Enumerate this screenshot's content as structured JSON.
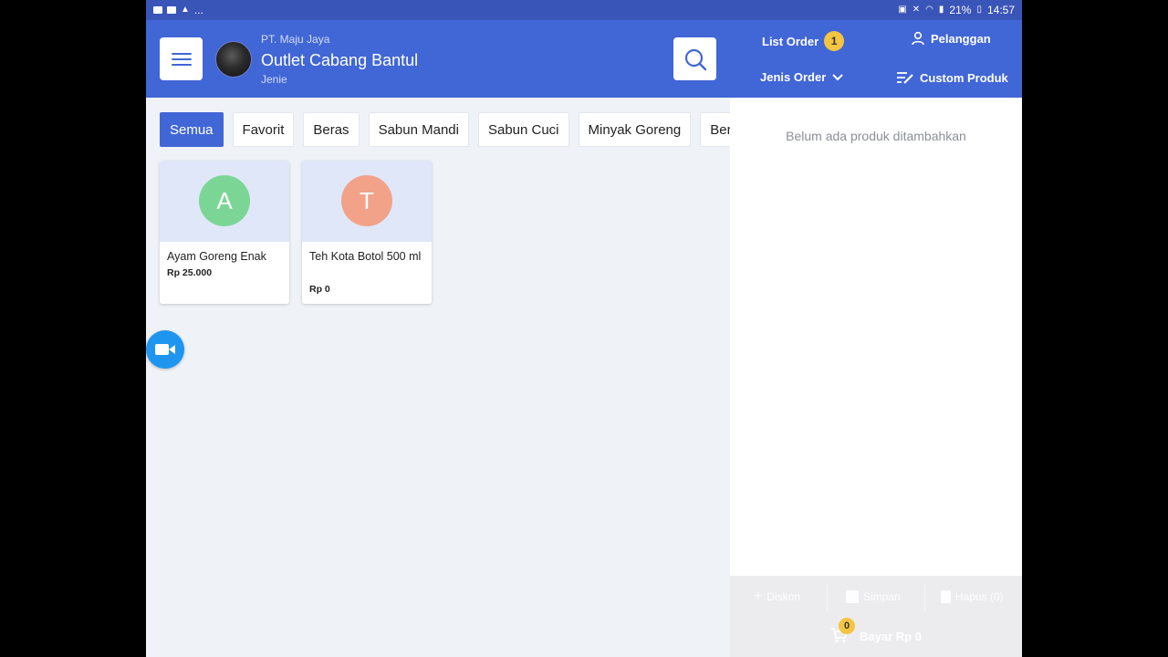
{
  "statusbar": {
    "left_ellipsis": "...",
    "battery": "21%",
    "time": "14:57"
  },
  "header": {
    "company": "PT. Maju Jaya",
    "outlet": "Outlet Cabang Bantul",
    "cashier": "Jenie"
  },
  "right_header": {
    "list_order": "List Order",
    "order_count": "1",
    "pelanggan": "Pelanggan",
    "jenis_order": "Jenis Order",
    "custom_produk": "Custom Produk"
  },
  "tabs": [
    {
      "label": "Semua",
      "active": true
    },
    {
      "label": "Favorit"
    },
    {
      "label": "Beras"
    },
    {
      "label": "Sabun Mandi"
    },
    {
      "label": "Sabun Cuci"
    },
    {
      "label": "Minyak Goreng"
    },
    {
      "label": "Beras Premium"
    }
  ],
  "products": [
    {
      "letter": "A",
      "name": "Ayam Goreng Enak",
      "price": "Rp 25.000",
      "color": "#7bd695"
    },
    {
      "letter": "T",
      "name": "Teh Kota Botol 500 ml",
      "price": "Rp 0",
      "color": "#f3a28a"
    }
  ],
  "order_panel": {
    "empty_message": "Belum ada produk ditambahkan",
    "diskon": "Diskon",
    "simpan": "Simpan",
    "hapus": "Hapus (0)",
    "cart_count": "0",
    "bayar": "Bayar Rp 0"
  },
  "colors": {
    "primary": "#4166d5",
    "badge": "#f4c542",
    "fab": "#1e96f0"
  }
}
